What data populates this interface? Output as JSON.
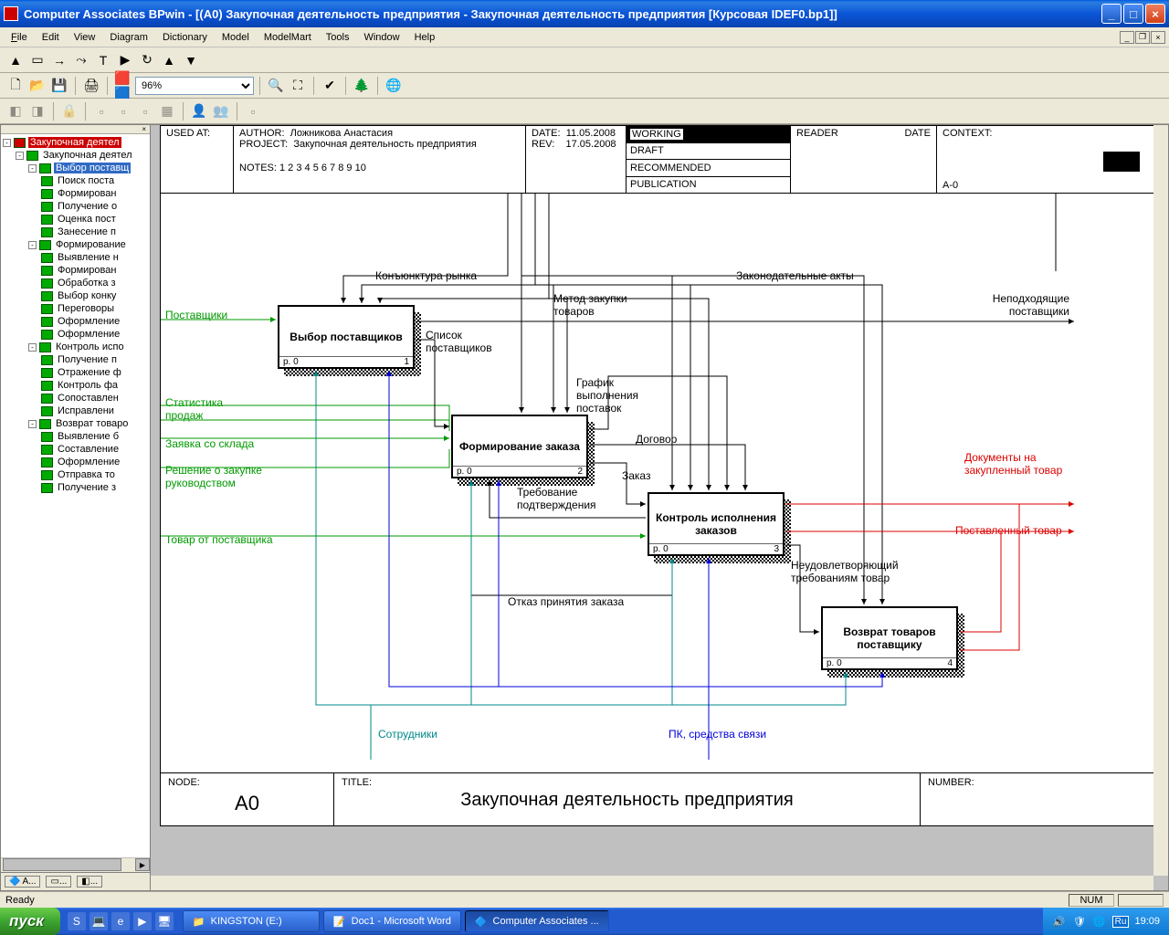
{
  "titlebar": {
    "title": "Computer Associates BPwin - [(A0) Закупочная деятельность предприятия - Закупочная деятельность предприятия  [Курсовая IDEF0.bp1]]"
  },
  "menu": {
    "file": "File",
    "edit": "Edit",
    "view": "View",
    "diagram": "Diagram",
    "dictionary": "Dictionary",
    "model": "Model",
    "modelmart": "ModelMart",
    "tools": "Tools",
    "window": "Window",
    "help": "Help"
  },
  "toolbar": {
    "zoom": "96%"
  },
  "tree": {
    "root": "Закупочная деятел",
    "l1": "Закупочная деятел",
    "sel": "Выбор поставщ",
    "l2": [
      "Поиск поста",
      "Формирован",
      "Получение  о",
      "Оценка  пост",
      "Занесение  п"
    ],
    "form": "Формирование",
    "form_items": [
      "Выявление н",
      "Формирован",
      "Обработка  з",
      "Выбор  конку",
      "Переговоры",
      "Оформление",
      "Оформление"
    ],
    "ctrl": "Контроль  испо",
    "ctrl_items": [
      "Получение  п",
      "Отражение  ф",
      "Контроль фа",
      "Сопоставлен",
      "Исправлени"
    ],
    "ret": "Возврат товаро",
    "ret_items": [
      "Выявление  б",
      "Составление",
      "Оформление",
      "Отправка  то",
      "Получение  з"
    ],
    "tab1": "A..."
  },
  "header": {
    "used_at": "USED AT:",
    "author": "AUTHOR:",
    "author_val": "Ложникова Анастасия",
    "project": "PROJECT:",
    "project_val": "Закупочная деятельность предприятия",
    "notes": "NOTES:  1  2  3  4  5  6  7  8  9  10",
    "date": "DATE:",
    "date_val": "11.05.2008",
    "rev": "REV:",
    "rev_val": "17.05.2008",
    "working": "WORKING",
    "draft": "DRAFT",
    "recommended": "RECOMMENDED",
    "publication": "PUBLICATION",
    "reader": "READER",
    "hdate": "DATE",
    "context": "CONTEXT:",
    "context_val": "A-0"
  },
  "footer": {
    "node": "NODE:",
    "node_val": "A0",
    "title": "TITLE:",
    "title_val": "Закупочная деятельность предприятия",
    "number": "NUMBER:"
  },
  "boxes": {
    "b1": "Выбор поставщиков",
    "b1p": "p. 0",
    "b1n": "1",
    "b2": "Формирование заказа",
    "b2p": "p. 0",
    "b2n": "2",
    "b3": "Контроль исполнения заказов",
    "b3p": "p. 0",
    "b3n": "3",
    "b4": "Возврат товаров поставщику",
    "b4p": "p. 0",
    "b4n": "4"
  },
  "labels": {
    "konyunktura": "Конъюнктура рынка",
    "zakon": "Законодательные акты",
    "metod": "Метод закупки товаров",
    "postavshiki": "Поставщики",
    "spisok": "Список поставщиков",
    "nepodh": "Неподходящие поставщики",
    "grafik": "График выполнения поставок",
    "dogovor": "Договор",
    "zakaz": "Заказ",
    "trebovanie": "Требование подтверждения",
    "otkaz": "Отказ принятия заказа",
    "statistika": "Статистика продаж",
    "zayavka": "Заявка со склада",
    "reshenie": "Решение о закупке руководством",
    "tovar_ot": "Товар от поставщика",
    "sotrudniki": "Сотрудники",
    "pk": "ПК, средства связи",
    "dokumenty": "Документы на закупленный товар",
    "postavlenny": "Поставленный товар",
    "neud": "Неудовлетворяющий требованиям товар"
  },
  "statusbar": {
    "ready": "Ready",
    "num": "NUM"
  },
  "taskbar": {
    "start": "пуск",
    "item1": "KINGSTON (E:)",
    "item2": "Doc1 - Microsoft Word",
    "item3": "Computer Associates ...",
    "lang": "Ru",
    "time": "19:09"
  }
}
